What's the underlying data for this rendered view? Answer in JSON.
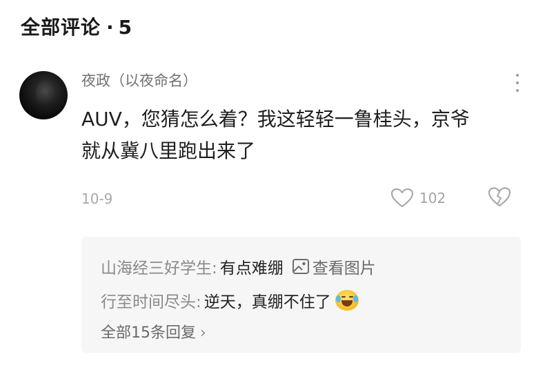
{
  "header": {
    "title": "全部评论",
    "separator": "·",
    "count": "5"
  },
  "comment": {
    "username": "夜政（以夜命名）",
    "lines": [
      "AUV，您猜怎么着？我这轻轻一鲁桂头，京爷",
      "就从冀八里跑出来了"
    ],
    "date": "10-9",
    "like_count": "102",
    "icons": {
      "avatar": "user-avatar",
      "more": "more-vertical-icon",
      "like": "heart-icon",
      "dislike": "broken-heart-icon"
    }
  },
  "replies": {
    "items": [
      {
        "author": "山海经三好学生:",
        "text": "有点难绷",
        "attachment_label": "查看图片"
      },
      {
        "author": "行至时间尽头:",
        "text": "逆天，真绷不住了"
      }
    ],
    "all_label": "全部15条回复",
    "chevron": "›"
  },
  "colors": {
    "reply_bg": "#f6f6f6",
    "muted_text": "#8a8a8a",
    "body_text": "#1e1e1e"
  }
}
